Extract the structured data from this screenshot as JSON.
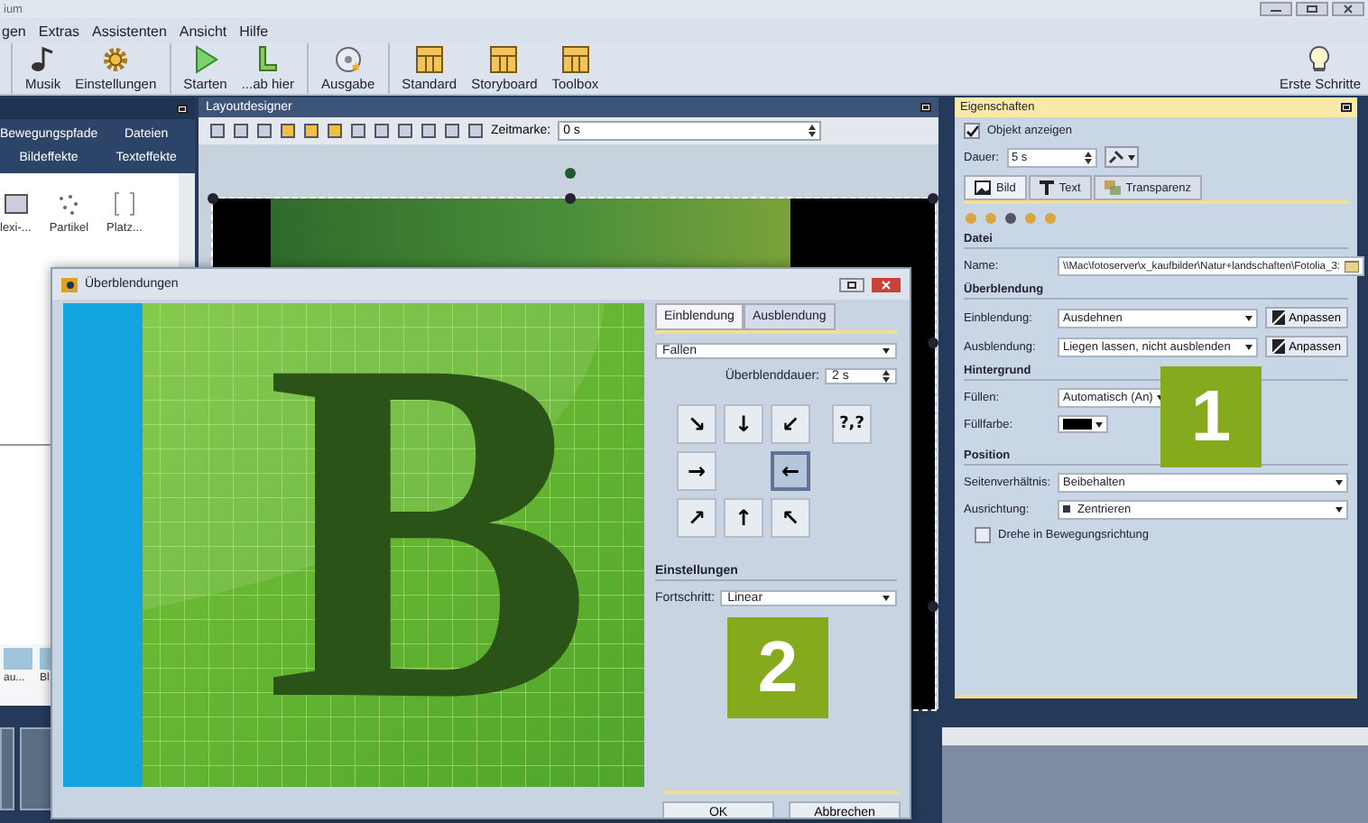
{
  "window": {
    "title": "ium"
  },
  "menu": [
    {
      "label": "gen"
    },
    {
      "label": "Extras"
    },
    {
      "label": "Assistenten"
    },
    {
      "label": "Ansicht"
    },
    {
      "label": "Hilfe"
    }
  ],
  "toolbar": {
    "groups": [
      [
        {
          "label": "Musik",
          "kind": "music"
        },
        {
          "label": "Einstellungen",
          "kind": "settings"
        }
      ],
      [
        {
          "label": "Starten",
          "kind": "play"
        },
        {
          "label": "...ab hier",
          "kind": "play-from"
        }
      ],
      [
        {
          "label": "Ausgabe",
          "kind": "output"
        }
      ],
      [
        {
          "label": "Standard",
          "kind": "layout"
        },
        {
          "label": "Storyboard",
          "kind": "layout"
        },
        {
          "label": "Toolbox",
          "kind": "layout"
        }
      ]
    ],
    "help_button": {
      "label": "Erste Schritte"
    }
  },
  "left_panel": {
    "tabs": [
      {
        "label": "Bewegungspfade"
      },
      {
        "label": "Dateien"
      },
      {
        "label": "Bildeffekte"
      },
      {
        "label": "Texteffekte"
      }
    ],
    "effects": [
      {
        "label": "lexi-...",
        "kind": "frame"
      },
      {
        "label": "Partikel",
        "kind": "particles"
      },
      {
        "label": "Platz...",
        "kind": "placeholder"
      }
    ],
    "clips": [
      {
        "label": "au..."
      },
      {
        "label": "Bl"
      }
    ]
  },
  "layout_designer": {
    "title": "Layoutdesigner",
    "time_label": "Zeitmarke:",
    "time_value": "0 s"
  },
  "properties": {
    "title": "Eigenschaften",
    "show_object": {
      "label": "Objekt anzeigen",
      "checked": true
    },
    "duration": {
      "label": "Dauer:",
      "value": "5 s"
    },
    "tabs": [
      {
        "label": "Bild",
        "kind": "image",
        "selected": true
      },
      {
        "label": "Text",
        "kind": "text",
        "selected": false
      },
      {
        "label": "Transparenz",
        "kind": "transparency",
        "selected": false
      }
    ],
    "file": {
      "heading": "Datei",
      "label": "Name:",
      "value": "\\\\Mac\\fotoserver\\x_kaufbilder\\Natur+landschaften\\Fotolia_3:"
    },
    "transition": {
      "heading": "Überblendung",
      "rows": [
        {
          "label": "Einblendung:",
          "value": "Ausdehnen",
          "button": "Anpassen"
        },
        {
          "label": "Ausblendung:",
          "value": "Liegen lassen, nicht ausblenden",
          "button": "Anpassen"
        }
      ]
    },
    "background": {
      "heading": "Hintergrund",
      "fill_label": "Füllen:",
      "fill_value": "Automatisch (An)",
      "color_label": "Füllfarbe:",
      "color": "#000000"
    },
    "position": {
      "heading": "Position",
      "aspect_label": "Seitenverhältnis:",
      "aspect_value": "Beibehalten",
      "align_label": "Ausrichtung:",
      "align_value": "Zentrieren",
      "rotate": {
        "label": "Drehe in Bewegungsrichtung",
        "checked": false
      }
    }
  },
  "dialog": {
    "title": "Überblendungen",
    "preview": {
      "letter": "B"
    },
    "tabs": [
      {
        "label": "Einblendung",
        "selected": true
      },
      {
        "label": "Ausblendung",
        "selected": false
      }
    ],
    "effect": "Fallen",
    "duration_label": "Überblenddauer:",
    "duration_value": "2 s",
    "directions": [
      {
        "kind": "arrow",
        "label": "↘",
        "selected": false
      },
      {
        "kind": "arrow",
        "label": "↓",
        "selected": false
      },
      {
        "kind": "arrow",
        "label": "↙",
        "selected": false
      },
      {
        "kind": "random",
        "label": "?,?",
        "selected": false
      },
      {
        "kind": "arrow",
        "label": "→",
        "selected": false
      },
      {
        "kind": "blank"
      },
      {
        "kind": "arrow",
        "label": "←",
        "selected": true
      },
      {
        "kind": "blank"
      },
      {
        "kind": "arrow",
        "label": "↗",
        "selected": false
      },
      {
        "kind": "arrow",
        "label": "↑",
        "selected": false
      },
      {
        "kind": "arrow",
        "label": "↖",
        "selected": false
      }
    ],
    "settings_heading": "Einstellungen",
    "progress_label": "Fortschritt:",
    "progress_value": "Linear",
    "buttons": [
      {
        "label": "OK"
      },
      {
        "label": "Abbrechen"
      }
    ]
  },
  "callouts": [
    {
      "label": "1"
    },
    {
      "label": "2"
    }
  ]
}
